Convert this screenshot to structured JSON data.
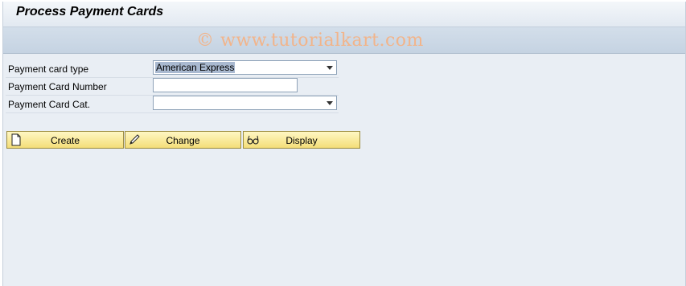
{
  "window": {
    "title": "Process Payment Cards"
  },
  "watermark": {
    "text": "© www.tutorialkart.com"
  },
  "form": {
    "fields": [
      {
        "label": "Payment card type",
        "value": "American Express",
        "type": "dropdown"
      },
      {
        "label": "Payment Card Number",
        "value": "",
        "type": "input"
      },
      {
        "label": "Payment Card Cat.",
        "value": "",
        "type": "dropdown"
      }
    ]
  },
  "buttons": {
    "create": {
      "label": "Create",
      "icon": "new-document-icon"
    },
    "change": {
      "label": "Change",
      "icon": "pencil-icon"
    },
    "display": {
      "label": "Display",
      "icon": "glasses-icon"
    }
  },
  "colors": {
    "button_bg": "#f4de78",
    "watermark": "#f2b48a",
    "background": "#e9eef4"
  }
}
